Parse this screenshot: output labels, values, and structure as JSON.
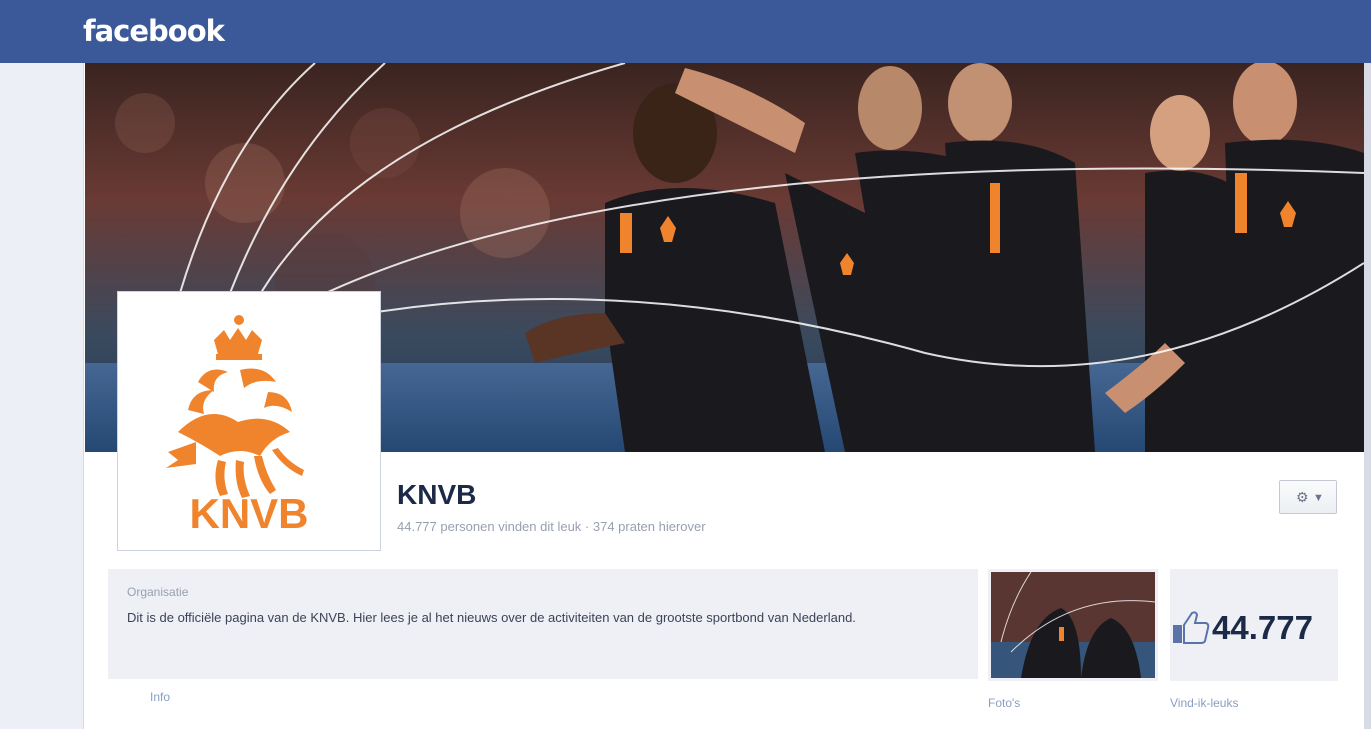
{
  "topbar": {
    "brand": "facebook"
  },
  "profile": {
    "logo_text": "KNVB",
    "name": "KNVB",
    "stats": "44.777 personen vinden dit leuk · 374 praten hierover"
  },
  "about": {
    "category": "Organisatie",
    "description": "Dit is de officiële pagina van de KNVB. Hier lees je al het nieuws over de activiteiten van de grootste sportbond van Nederland.",
    "info_label": "Info"
  },
  "apps": {
    "photos_label": "Foto's",
    "likes_count": "44.777",
    "likes_label": "Vind-ik-leuks"
  },
  "colors": {
    "header": "#3b5998",
    "knvb_orange": "#f0842d",
    "panel": "#eef0f5"
  },
  "icons": {
    "settings": "gear-icon",
    "dropdown": "chevron-down-icon",
    "like": "thumbs-up-icon"
  }
}
